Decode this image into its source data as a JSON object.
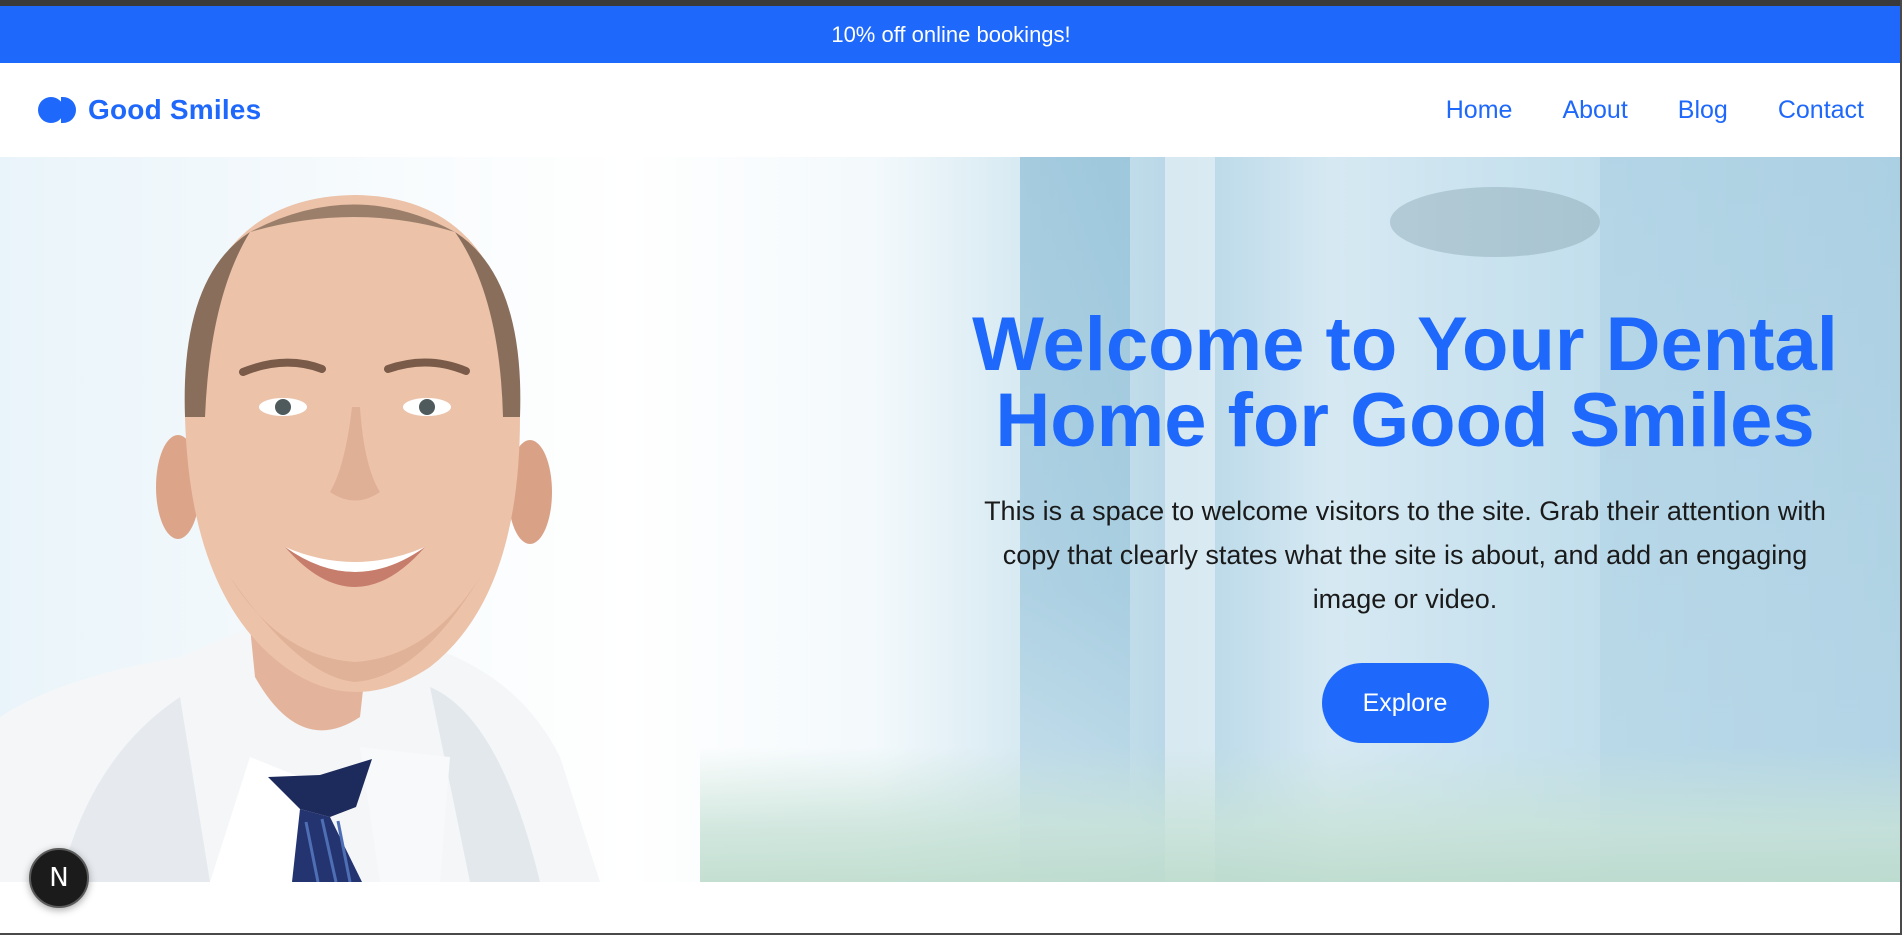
{
  "promo": {
    "text": "10% off online bookings!"
  },
  "brand": {
    "name": "Good Smiles",
    "logo_icon": "two-dots-logo-icon"
  },
  "nav": {
    "items": [
      {
        "label": "Home"
      },
      {
        "label": "About"
      },
      {
        "label": "Blog"
      },
      {
        "label": "Contact"
      }
    ]
  },
  "hero": {
    "title": "Welcome to Your Dental Home for Good Smiles",
    "text": "This is a space to welcome visitors to the site. Grab their attention with copy that clearly states what the site is about, and add an engaging image or video.",
    "button_label": "Explore",
    "image": "smiling-dentist-in-white-coat"
  },
  "dev_badge": {
    "label": "N"
  },
  "colors": {
    "accent": "#1e68fc",
    "text": "#1a1a1a",
    "promo_bg": "#1e68fc"
  }
}
